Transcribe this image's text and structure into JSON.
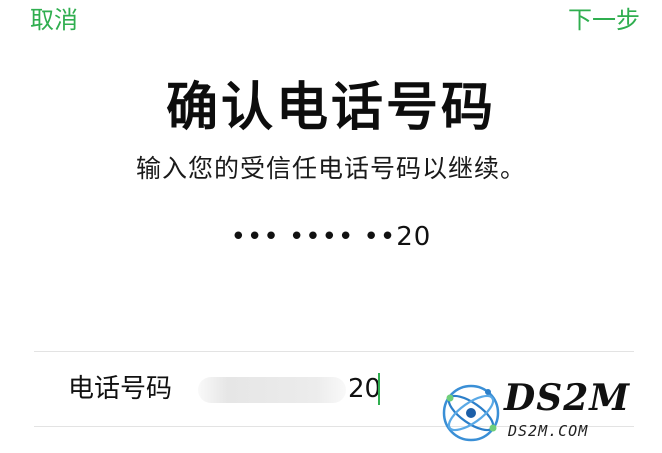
{
  "nav": {
    "cancel_label": "取消",
    "next_label": "下一步",
    "accent_color": "#2fae4f"
  },
  "header": {
    "title": "确认电话号码",
    "subtitle": "输入您的受信任电话号码以继续。"
  },
  "masked_number": "••• •••• ••20",
  "form": {
    "phone_label": "电话号码",
    "phone_value_visible": "20",
    "phone_value_obscured": true
  },
  "watermark": {
    "logo_icon": "atom-icon",
    "text": "DS2M",
    "url": "DS2M.COM"
  }
}
